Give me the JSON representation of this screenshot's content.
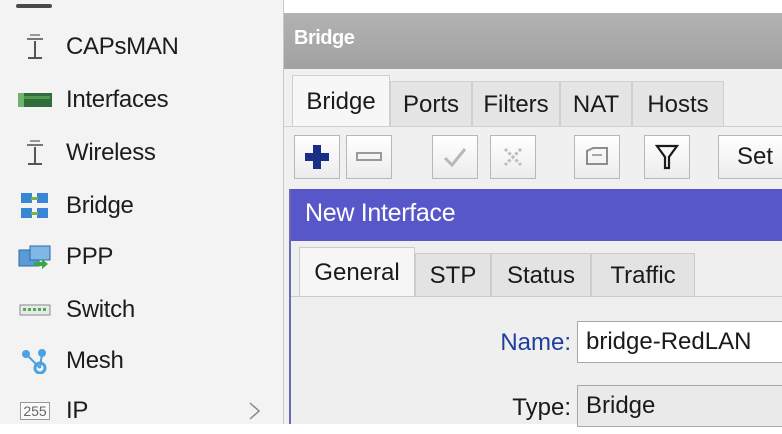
{
  "sidebar": {
    "items": [
      {
        "label": "CAPsMAN",
        "icon": "antenna-icon"
      },
      {
        "label": "Interfaces",
        "icon": "interfaces-icon"
      },
      {
        "label": "Wireless",
        "icon": "wireless-icon"
      },
      {
        "label": "Bridge",
        "icon": "bridge-icon"
      },
      {
        "label": "PPP",
        "icon": "ppp-icon"
      },
      {
        "label": "Switch",
        "icon": "switch-icon"
      },
      {
        "label": "Mesh",
        "icon": "mesh-icon"
      },
      {
        "label": "IP",
        "icon": "ip-icon",
        "icon_text": "255"
      }
    ]
  },
  "bridge_window": {
    "title": "Bridge",
    "tabs": [
      "Bridge",
      "Ports",
      "Filters",
      "NAT",
      "Hosts"
    ],
    "active_tab": "Bridge",
    "toolbar": {
      "settings_label": "Set"
    }
  },
  "dialog": {
    "title": "New Interface",
    "tabs": [
      "General",
      "STP",
      "Status",
      "Traffic"
    ],
    "active_tab": "General",
    "fields": {
      "name_label": "Name:",
      "name_value": "bridge-RedLAN",
      "type_label": "Type:",
      "type_value": "Bridge"
    }
  },
  "colors": {
    "dialog_title_bg": "#5757c9",
    "window_title_bg": "#a9a9a9",
    "name_label_color": "#1f3f9e",
    "add_icon_color": "#1b2e86"
  }
}
